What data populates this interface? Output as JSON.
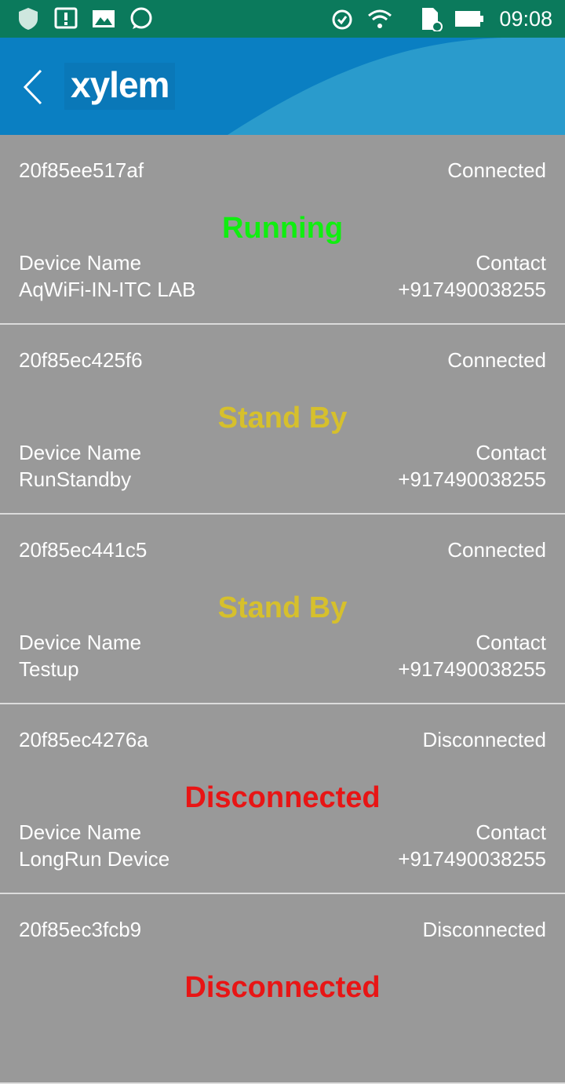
{
  "status_bar": {
    "time": "09:08",
    "icons_left": [
      "shield-icon",
      "alert-icon",
      "image-icon",
      "whatsapp-icon"
    ],
    "icons_right": [
      "alarm-icon",
      "wifi-icon",
      "sd-card-icon",
      "battery-icon"
    ]
  },
  "header": {
    "logo": "xylem",
    "back_icon": "chevron-left-icon",
    "colors": {
      "bar": "#0a7fc2",
      "wave": "#2a9bcc"
    }
  },
  "status_colors": {
    "Running": "#10ee10",
    "Stand By": "#d6c02c",
    "Disconnected": "#e81515"
  },
  "devices": [
    {
      "id": "20f85ee517af",
      "connection": "Connected",
      "status": "Running",
      "name_label": "Device Name",
      "name": "AqWiFi-IN-ITC LAB",
      "contact_label": "Contact",
      "contact": "+917490038255"
    },
    {
      "id": "20f85ec425f6",
      "connection": "Connected",
      "status": "Stand By",
      "name_label": "Device Name",
      "name": "RunStandby",
      "contact_label": "Contact",
      "contact": "+917490038255"
    },
    {
      "id": "20f85ec441c5",
      "connection": "Connected",
      "status": "Stand By",
      "name_label": "Device Name",
      "name": "Testup",
      "contact_label": "Contact",
      "contact": "+917490038255"
    },
    {
      "id": "20f85ec4276a",
      "connection": "Disconnected",
      "status": "Disconnected",
      "name_label": "Device Name",
      "name": "LongRun Device",
      "contact_label": "Contact",
      "contact": "+917490038255"
    },
    {
      "id": "20f85ec3fcb9",
      "connection": "Disconnected",
      "status": "Disconnected"
    }
  ]
}
